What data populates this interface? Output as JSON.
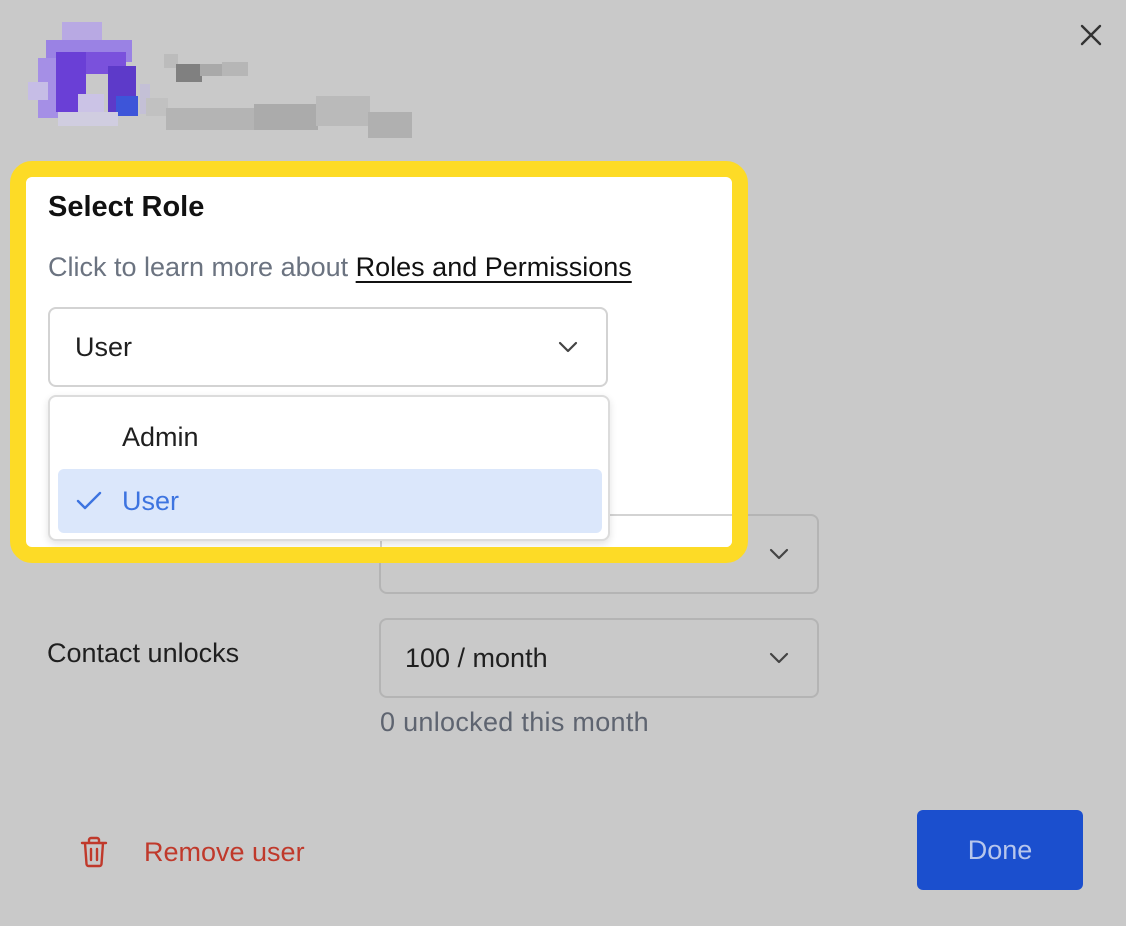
{
  "dialog": {
    "close_icon": "close-icon"
  },
  "role_popover": {
    "title": "Select Role",
    "subtitle_prefix": "Click to learn more about",
    "subtitle_link": "Roles and Permissions",
    "selected_value": "User",
    "options": [
      {
        "label": "Admin",
        "selected": false
      },
      {
        "label": "User",
        "selected": true
      }
    ],
    "highlight_color": "#fddb26",
    "selected_bg": "#dbe7fb",
    "selected_text_color": "#3d74e0"
  },
  "fields": {
    "contact_unlocks_label": "Contact unlocks",
    "contact_unlocks_value": "100 / month",
    "contact_unlocks_hint": "0 unlocked this month"
  },
  "footer": {
    "remove_label": "Remove user",
    "remove_color": "#c0392b",
    "done_label": "Done",
    "done_color": "#1b4fce"
  }
}
